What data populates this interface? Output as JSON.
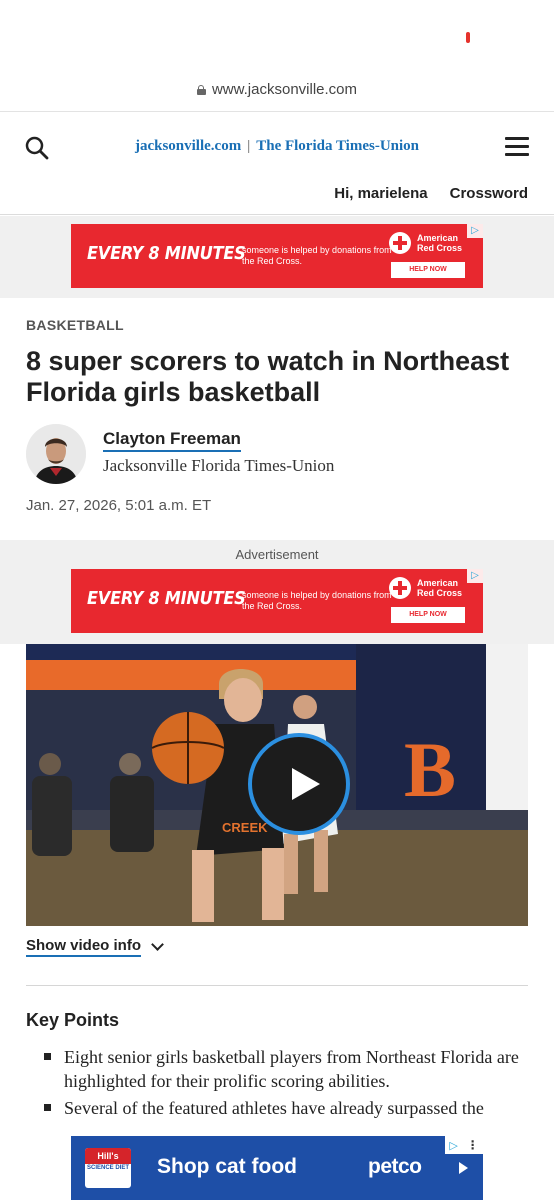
{
  "browser": {
    "url": "www.jacksonville.com"
  },
  "site": {
    "brand_primary": "jacksonville.com",
    "brand_separator": "|",
    "brand_secondary": "The Florida Times-Union",
    "greeting": "Hi, marielena",
    "crossword": "Crossword",
    "accent_color": "#1a6fb5"
  },
  "ads": {
    "red_cross": {
      "headline": "EVERY 8 MINUTES",
      "subtext": "someone is helped by donations from the Red Cross.",
      "org_line1": "American",
      "org_line2": "Red Cross",
      "cta": "HELP NOW",
      "ad_choice": "▷"
    },
    "advertisement_label": "Advertisement",
    "petco": {
      "hills_top": "Hill's",
      "hills_bottom": "SCIENCE DIET",
      "headline": "Shop cat food",
      "brand": "petco",
      "ad_choice": "▷",
      "more": "⋮"
    }
  },
  "article": {
    "section": "BASKETBALL",
    "headline": "8 super scorers to watch in Northeast Florida girls basketball",
    "author": "Clayton Freeman",
    "author_org": "Jacksonville Florida Times-Union",
    "date": "Jan. 27, 2026, 5:01 a.m. ET",
    "video_info_label": "Show video info",
    "key_points_title": "Key Points",
    "key_points": [
      "Eight senior girls basketball players from Northeast Florida are highlighted for their prolific scoring abilities.",
      "Several of the featured athletes have already surpassed the"
    ]
  }
}
